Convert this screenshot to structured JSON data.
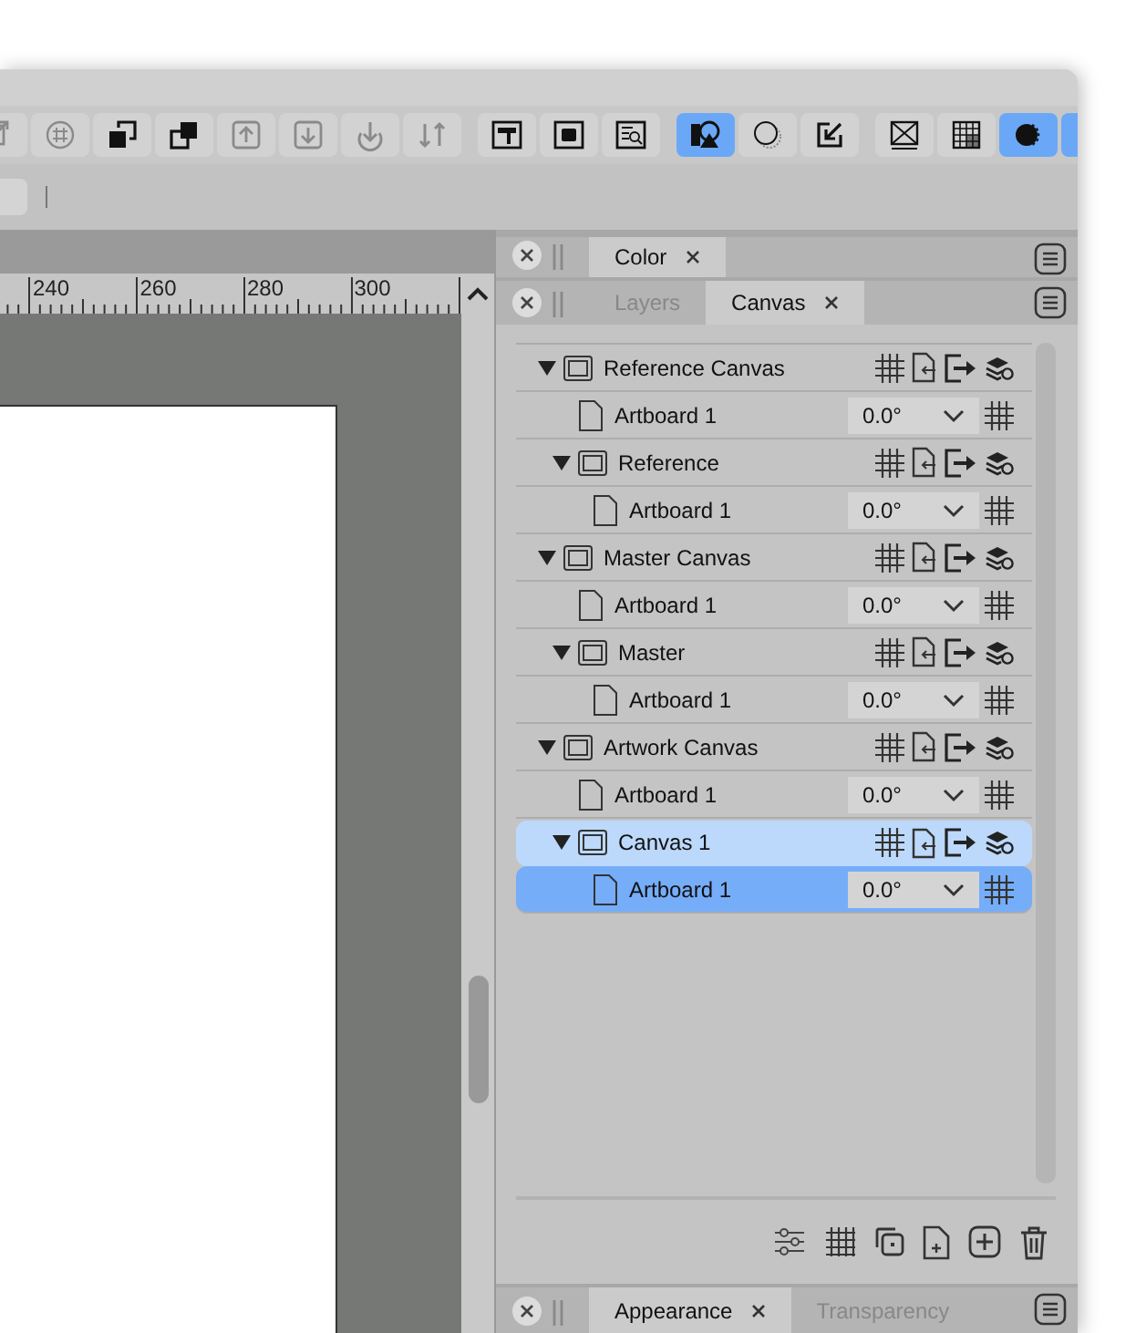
{
  "toolbar": {
    "groups": [
      [
        {
          "selected": false,
          "disabled": true
        },
        {
          "selected": false,
          "disabled": true
        },
        {
          "selected": false,
          "disabled": false
        },
        {
          "selected": false,
          "disabled": false
        },
        {
          "selected": false,
          "disabled": true
        },
        {
          "selected": false,
          "disabled": true
        },
        {
          "selected": false,
          "disabled": true
        },
        {
          "selected": false,
          "disabled": true
        }
      ],
      [
        {
          "selected": false,
          "disabled": false
        },
        {
          "selected": false,
          "disabled": false
        },
        {
          "selected": false,
          "disabled": false
        }
      ],
      [
        {
          "selected": true,
          "disabled": false
        },
        {
          "selected": false,
          "disabled": false
        },
        {
          "selected": false,
          "disabled": false
        }
      ],
      [
        {
          "selected": false,
          "disabled": false
        },
        {
          "selected": false,
          "disabled": false
        },
        {
          "selected": true,
          "disabled": false
        },
        {
          "selected": true,
          "disabled": false
        }
      ]
    ]
  },
  "ruler": {
    "labels": [
      "240",
      "260",
      "280",
      "300"
    ]
  },
  "panels": [
    {
      "tabs": [
        {
          "label": "Color",
          "selected": true
        }
      ]
    },
    {
      "tabs": [
        {
          "label": "Layers",
          "selected": false
        },
        {
          "label": "Canvas",
          "selected": true
        }
      ]
    }
  ],
  "tree": [
    {
      "kind": "canvas",
      "label": "Reference Canvas",
      "expanded": true,
      "selected": false,
      "children": [
        {
          "kind": "artboard",
          "label": "Artboard 1",
          "rotation": "0.0°",
          "selected": false
        },
        {
          "kind": "canvas",
          "label": "Reference",
          "expanded": true,
          "selected": false,
          "children": [
            {
              "kind": "artboard",
              "label": "Artboard 1",
              "rotation": "0.0°",
              "selected": false
            }
          ]
        }
      ]
    },
    {
      "kind": "canvas",
      "label": "Master Canvas",
      "expanded": true,
      "selected": false,
      "children": [
        {
          "kind": "artboard",
          "label": "Artboard 1",
          "rotation": "0.0°",
          "selected": false
        },
        {
          "kind": "canvas",
          "label": "Master",
          "expanded": true,
          "selected": false,
          "children": [
            {
              "kind": "artboard",
              "label": "Artboard 1",
              "rotation": "0.0°",
              "selected": false
            }
          ]
        }
      ]
    },
    {
      "kind": "canvas",
      "label": "Artwork Canvas",
      "expanded": true,
      "selected": false,
      "children": [
        {
          "kind": "artboard",
          "label": "Artboard 1",
          "rotation": "0.0°",
          "selected": false
        },
        {
          "kind": "canvas",
          "label": "Canvas 1",
          "expanded": true,
          "selected": false,
          "children": [
            {
              "kind": "artboard",
              "label": "Artboard 1",
              "rotation": "0.0°",
              "selected": true
            }
          ]
        }
      ]
    }
  ],
  "bottom_panel": {
    "tabs": [
      {
        "label": "Appearance",
        "selected": true
      },
      {
        "label": "Transparency",
        "selected": false
      }
    ]
  }
}
